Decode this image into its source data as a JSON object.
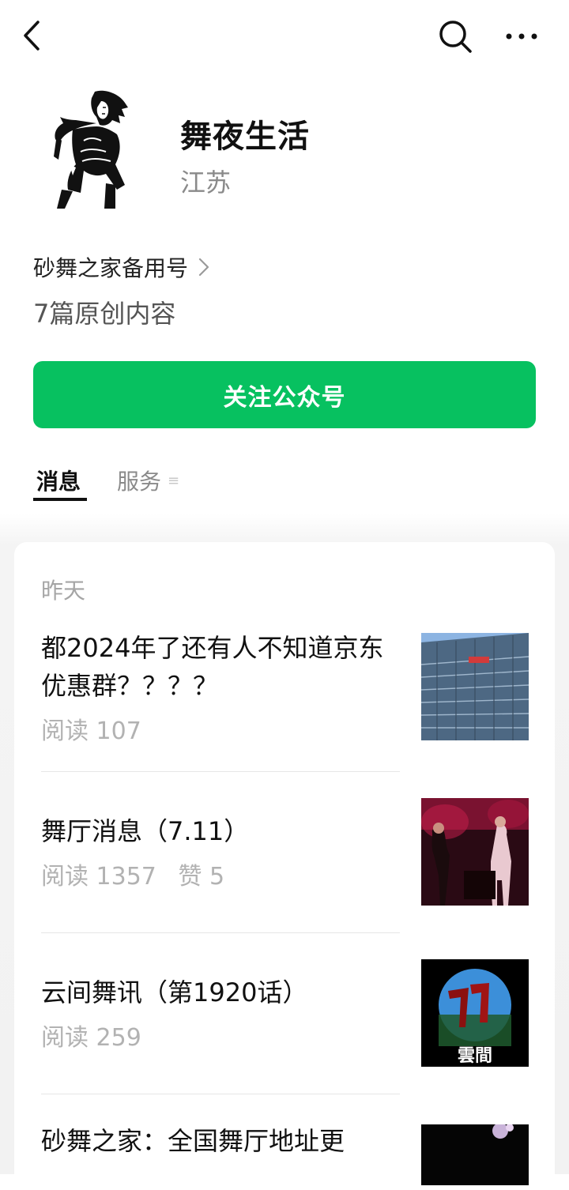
{
  "header": {
    "back_icon": "chevron-left-icon",
    "search_icon": "search-icon",
    "more_icon": "more-horizontal-icon"
  },
  "account": {
    "name": "舞夜生活",
    "region": "江苏",
    "subject": "砂舞之家备用号",
    "original_count": "7篇原创内容",
    "follow_label": "关注公众号",
    "accent_color": "#07c160"
  },
  "tabs": {
    "messages": "消息",
    "services": "服务",
    "services_icon": "≡"
  },
  "feed": {
    "date_label": "昨天",
    "items": [
      {
        "title": "都2024年了还有人不知道京东优惠群？？？？",
        "reads": "阅读 107",
        "likes": ""
      },
      {
        "title": "舞厅消息（7.11）",
        "reads": "阅读 1357",
        "likes": "赞 5"
      },
      {
        "title": "云间舞讯（第1920话）",
        "reads": "阅读 259",
        "likes": "",
        "thumb_caption": "雲間"
      },
      {
        "title": "砂舞之家：全国舞厅地址更",
        "reads": "",
        "likes": ""
      }
    ]
  }
}
